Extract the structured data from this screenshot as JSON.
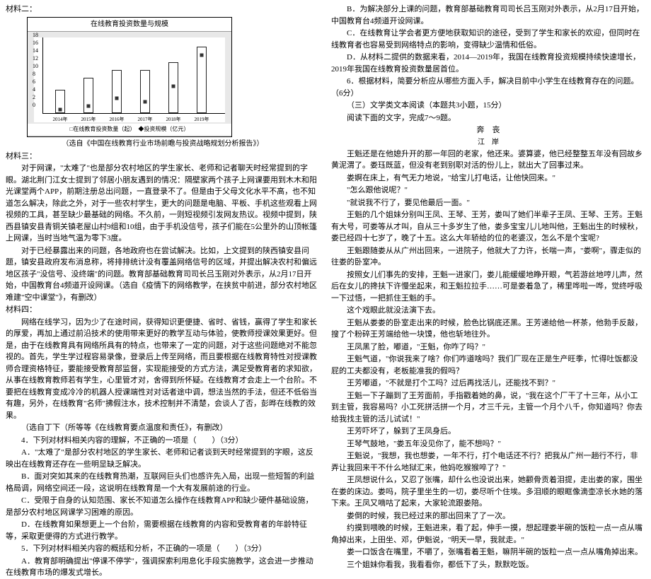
{
  "chart_data": {
    "type": "bar+line",
    "title": "在线教育投资数量与规模",
    "categories": [
      "2014年",
      "2015年",
      "2016年",
      "2017年",
      "2018年",
      "2019年"
    ],
    "series": [
      {
        "name": "在线教育投资数量（起）",
        "type": "bar",
        "values": [
          6,
          9,
          11,
          11,
          13,
          17
        ]
      },
      {
        "name": "投资规模（亿元）",
        "type": "line",
        "values": [
          1,
          2,
          4,
          3,
          7,
          15
        ]
      }
    ],
    "ylim": [
      0,
      18
    ],
    "yticks": [
      0,
      2,
      4,
      6,
      8,
      10,
      12,
      14,
      16,
      18
    ],
    "legend": "□在线教育投资数量（起）　◆投资规模（亿元）",
    "source": "（选自《中国在线教育行业市场前瞻与投资战略规划分析报告》）"
  },
  "left": {
    "h1": "材料二：",
    "h2": "材料三：",
    "p1": "对于网课，\"太难了\"也是部分农村地区的学生家长、老师和记者聊天时经常提到的字眼。湖北荆门江女士提到了邻居小朋友遇到的情况：隔壁家两个孩子上网课要用到木木和阳光课堂两个APP，前期注册总出问题，一直登录不了。但是由于父母文化水平不高，也不知道怎么解决，除此之外，对于一些农村学生，更大的问题是电脑、平板、手机这些观看上网视频的工具，甚至缺少最基础的网络。不久前，一则短视频引发网友热议。视频中提到，陕西县镇安县青铜关镇老屋山村9组和10组，由于手机没信号，孩子们能在5公里外的山顶帐篷上网课，当时当地气温为零下3度。",
    "p2": "对于已经暴露出来的问题，各地政府也在尝试解决。比如，上文提到的陕西镇安县问题，镇安县政府发布消息称，将排排统计没有覆盖网络信号的区域，并提出解决农村和偏远地区孩子\"没信号、没终端\"的问题。教育部基础教育司司长吕玉刚对外表示，从2月17日开始，中国教育台4频道开设网课。（选自《疫情下的网络教学，在挟贫中前进，部分农村地区难建\"空中课堂\"》，有删改）",
    "h3": "材料四：",
    "p3": "网络在线学习，因为少了在途时间，获得知识更便捷、省时、省钱，赢得了学生和家长的厚爱，再加上通过前沿技术的使用带来更好的教学互动与体验，使教师授课效果更好。但是，由于在线教育具有网络所具有的特点，也带来了一定的问题，对于这些问题绝对不能忽视的。首先，学生学过程容易录像，登录后上传至网络，而且要根据在线教育特性对授课教师合理资格特征，要能接受教育部监督，实现能接受的方式方法，满足受教育者的求知欲，从事在线教育教师若有学生，心里管才对，舍得到所怀疑。在线教育才会走上一个台阶。不要把在线教育变成冷冷的机器人授课端性对对话者途中调，想法当然的手法，但还不低俗当有趣，另外，在线教育\"名师\"拂假注水，技术控制并不清楚，会谈人了否，彭晔在线教的效果。",
    "p4": "（选自丁下（所等等《在线教育要点温度和责任》，有删改）",
    "q4": "4．下列对材料相关内容的理解，不正确的一项是（　　）（3分）",
    "q4a": "A．\"太难了\"是部分农村地区的学生家长、老师和记者谈到天时经常提到的字眼，这反映出在线教育还存在一些明显缺乏解决。",
    "q4b": "B．面对突如其来的在线教育热潮，互联网巨头们也感许先入局，出现一些短暂的利益格局调，网络空间还一段，这说明在线教育是一个大有发展前途的行业。",
    "q4c": "C．受限于自身的认知范围、家长不知道怎么操作在线教育APP和缺少硬件基础设施，是部分农村地区网课学习困难的原因。",
    "q4d": "D．在线教育如果想更上一个台阶，需要根据在线教育的内容和受教育者的年龄特征等，采取更便得的方式进行教学。",
    "q5": "5．下列对材料相关内容的概括和分析，不正确的一项是（　　）（3分）",
    "q5a": "A．教育部明确提出\"停课不停学\"，强调探索利用息化手段实施教学，这会进一步推动在线教育市场的爆发式增长。"
  },
  "right": {
    "r1": "B．为解决部分上课的问题，教育部基础教育司司长吕玉刚对外表示，从2月17日开始，中国教育台4频道开设网课。",
    "r2": "C．在线教育让学会者更方便地获取知识的途径，受到了学生和家长的欢迎，但同时在线教育者也容易受到网络特点的影响，变得缺少温情和低俗。",
    "r3": "D．从材料二提供的数据来看，2014—2019年，我国在线教育投资规模持续快速增长，2019年我国在线教育投资数量居首位。",
    "q6": "6．根据材料，简要分析应从哪些方面入手，解决目前中小学生在线教育存在的问题。　（6分）",
    "s1": "（三）文学类文本阅读（本题共3小题，15分）",
    "s2": "阅读下面的文字，完成7～9题。",
    "title": "奔　丧",
    "author": "江　岸",
    "t1": "王魁还是在他媳升开的那一年回的老家，他还来。婆算婆，他已经整整五年没有回故乡黄泥渭了。娄珏既蓝，但没有老到别职对活的份儿上，就出大了回事过来。",
    "t2": "娄婀在床上，有气无力地说，\"给宝儿打电话，让他快回来。\"",
    "t3": "\"怎么跟他说呢？\"",
    "t4": "\"就说我不行了，要见他最后一面。\"",
    "t5": "王魁的几个姐妹分别叫王凤、王琴、王芳，娄叫了她们半辈子王凤、王琴、王芳。王魁有大号，可娄等从才叫，自从三十多岁生了他，娄多宝宝儿儿地叫他，王魁出生的时候秋，娄已经四十七岁了，晚了十五。这么大年轿给的位的老婆汉，怎么不是个宝呢?",
    "t6": "王魁跟随娄从从广州出回来，一进院子，他就大了力许，长喘一声，\"娄啊\"，骤走似的往娄的卧室冲。",
    "t7": "按照女儿们事先的安排，王魁一进家门，娄儿能缓缓地睁开眼，气若游丝地哼儿声，然后在女儿的搀扶下许慢坐起来，和王魁拉拉手……可是娄着急了，稀里哗啦一哗，觉终呼吸一下过悟，一把抓住王魁的手。",
    "t8": "这个戏眼此就没法演下去。",
    "t9": "王魁从娄娄的卧室走出来的时候，脸色比锅底还黑。王芳递给他一杯茶，他勃手反敲，搜了个粉碎王芳端给他一块馍，他也斩地往外。",
    "t10": "王凤黑了脸，嘟道，\"王魁，你咋了吗？\"",
    "t11": "王魁气道，\"你说我来了啥？你们咋道啥吗？我们厂现在正是生产旺季，忙得吐饭都没屁的工夫都没有，老板能准我的假吗？",
    "t12": "王芳嘟道，\"不就是打个工吗？过后再找活儿，还能找不到？\"",
    "t13": "王魁一下子蹦到了王芳面前，手指戳着她的鼻，说，\"我在这个厂干了十三年，从小工到主管，我容易吗？小工死拼活拼一个月，才三千元，主管一个月个八千，你知道吗？你去给我找主管的活儿试试！\"",
    "t14": "王芳吓坏了，躲到了王凤身后。",
    "t15": "王琴气鼓地，\"娄五年没见你了，能不想吗？\"",
    "t16": "王魁说，\"我想，我也想娄，一年不行，打个电话还不行？把我从广州一趟行不行，非弄让我回来干不什么地狱汇来，他妈吃猴猴啐了？\"",
    "t17": "王凤想说什么，又忍了张嘴，却什么也没说出来，她颧骨贡着泪提，走出娄的家，围坐在娄的床边。娄吗，院子里坐生的一切，娄尽听个住埃。多泪顺的眼眶像滴壶凉长水她的落下来。王凤又嘀咕了起来，大家轮流跟娄陪。",
    "t18": "娄倒的时候，我已经过来的那出回来了了一次。",
    "t19": "约摸到喂晚的时候，王魁进来，看了起，伸手一摸，想起理娄半碗的饭粒一点一点从嘴角掉出来，上田坐、邓，伊魁说，\"明天一早，我就走。\"",
    "t20": "娄一口饭含在嘴里，不嚼了，张嘴看着王魁，嘛阴半碗的饭粒一点一点从嘴角掉出来。",
    "t21": "三个姐妹你看我，我看看你，都低下了头，默默吃饭。"
  }
}
